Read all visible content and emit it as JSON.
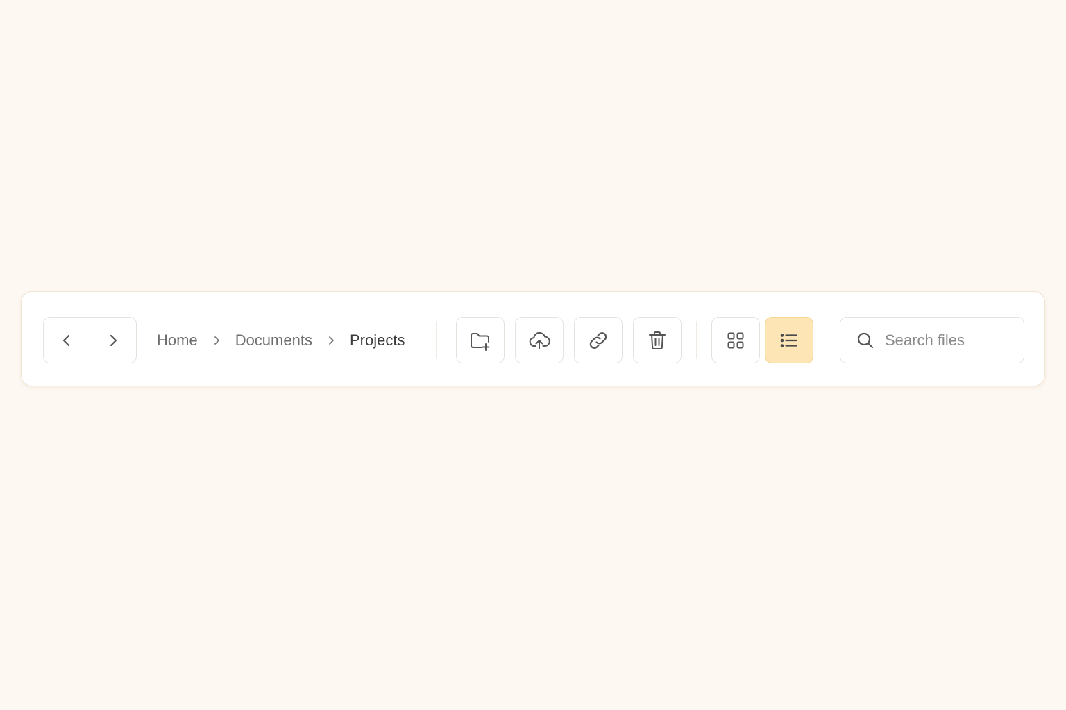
{
  "toolbar": {
    "nav": {
      "back_icon": "chevron-left-icon",
      "forward_icon": "chevron-right-icon"
    },
    "breadcrumb": {
      "items": [
        "Home",
        "Documents",
        "Projects"
      ],
      "separator_icon": "chevron-right-icon"
    },
    "actions": [
      {
        "name": "new-folder",
        "icon": "folder-plus-icon"
      },
      {
        "name": "upload",
        "icon": "cloud-upload-icon"
      },
      {
        "name": "copy-link",
        "icon": "link-icon"
      },
      {
        "name": "delete",
        "icon": "trash-icon"
      }
    ],
    "view_toggle": {
      "options": [
        {
          "name": "grid-view",
          "icon": "grid-icon",
          "active": false
        },
        {
          "name": "list-view",
          "icon": "list-icon",
          "active": true
        }
      ]
    },
    "search": {
      "placeholder": "Search files",
      "value": "",
      "icon": "search-icon"
    }
  },
  "colors": {
    "page_background": "#fdf8f2",
    "toolbar_background": "#ffffff",
    "border": "#e6e3df",
    "active_background": "#fde5b6",
    "active_border": "#f8d590",
    "icon": "#555555",
    "text_muted": "#6e6e6e",
    "text_current": "#3c3c3c"
  }
}
